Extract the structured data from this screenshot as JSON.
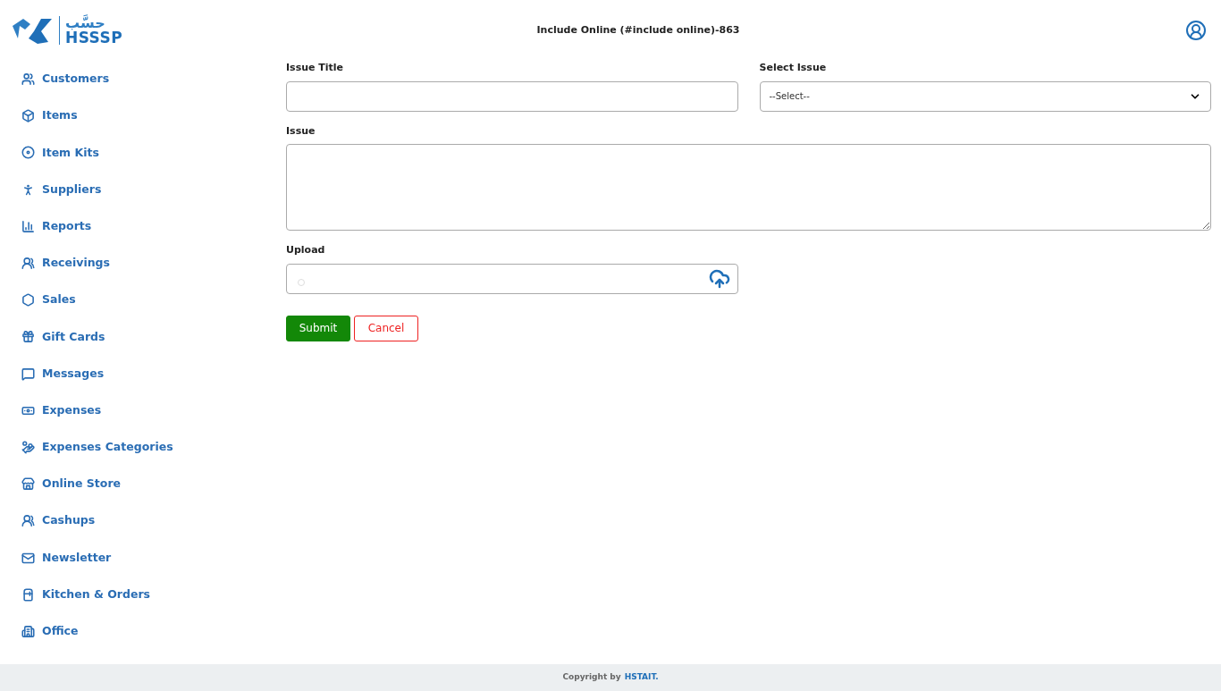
{
  "logo": {
    "arabic": "حسَّب",
    "latin": "HSSSP"
  },
  "header": {
    "title": "Include Online (#include online)-863"
  },
  "sidebar": {
    "items": [
      {
        "label": "Customers"
      },
      {
        "label": "Items"
      },
      {
        "label": "Item Kits"
      },
      {
        "label": "Suppliers"
      },
      {
        "label": "Reports"
      },
      {
        "label": "Receivings"
      },
      {
        "label": "Sales"
      },
      {
        "label": "Gift Cards"
      },
      {
        "label": "Messages"
      },
      {
        "label": "Expenses"
      },
      {
        "label": "Expenses Categories"
      },
      {
        "label": "Online Store"
      },
      {
        "label": "Cashups"
      },
      {
        "label": "Newsletter"
      },
      {
        "label": "Kitchen & Orders"
      },
      {
        "label": "Office"
      }
    ]
  },
  "form": {
    "issue_title": {
      "label": "Issue Title"
    },
    "select_issue": {
      "label": "Select Issue",
      "value": "--Select--"
    },
    "issue": {
      "label": "Issue"
    },
    "upload": {
      "label": "Upload"
    },
    "buttons": [
      {
        "label": "Submit",
        "kind": "primary"
      },
      {
        "label": "Cancel",
        "kind": "outline"
      }
    ]
  },
  "footer": {
    "text": "Copyright by",
    "link": "HSTAIT."
  }
}
